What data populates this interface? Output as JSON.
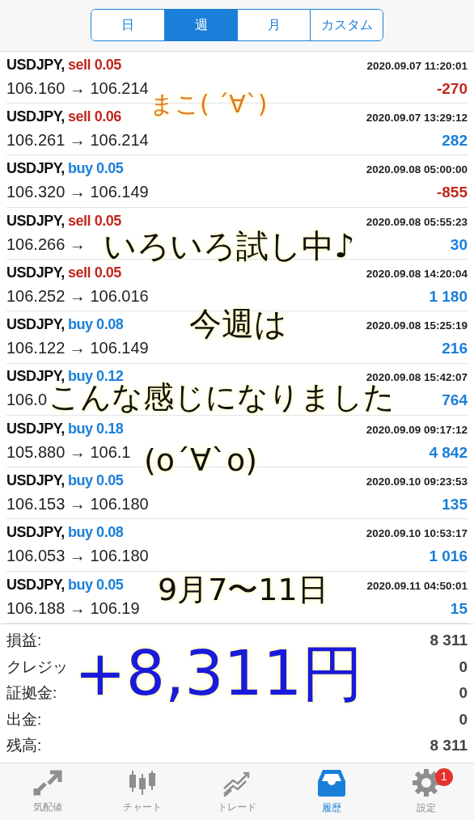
{
  "period_tabs": [
    {
      "label": "日",
      "selected": false
    },
    {
      "label": "週",
      "selected": true
    },
    {
      "label": "月",
      "selected": false
    },
    {
      "label": "カスタム",
      "selected": false
    }
  ],
  "deals": [
    {
      "symbol": "USDJPY,",
      "kind": "sell",
      "lot": "sell 0.05",
      "time": "2020.09.07 11:20:01",
      "prices": "106.160 → 106.214",
      "profit": "-270",
      "loss": true
    },
    {
      "symbol": "USDJPY,",
      "kind": "sell",
      "lot": "sell 0.06",
      "time": "2020.09.07 13:29:12",
      "prices": "106.261 → 106.214",
      "profit": "282",
      "loss": false
    },
    {
      "symbol": "USDJPY,",
      "kind": "buy",
      "lot": "buy 0.05",
      "time": "2020.09.08 05:00:00",
      "prices": "106.320 → 106.149",
      "profit": "-855",
      "loss": true
    },
    {
      "symbol": "USDJPY,",
      "kind": "sell",
      "lot": "sell 0.05",
      "time": "2020.09.08 05:55:23",
      "prices": "106.266 →",
      "profit": "30",
      "loss": false
    },
    {
      "symbol": "USDJPY,",
      "kind": "sell",
      "lot": "sell 0.05",
      "time": "2020.09.08 14:20:04",
      "prices": "106.252 → 106.016",
      "profit": "1 180",
      "loss": false
    },
    {
      "symbol": "USDJPY,",
      "kind": "buy",
      "lot": "buy 0.08",
      "time": "2020.09.08 15:25:19",
      "prices": "106.122 → 106.149",
      "profit": "216",
      "loss": false
    },
    {
      "symbol": "USDJPY,",
      "kind": "buy",
      "lot": "buy 0.12",
      "time": "2020.09.08 15:42:07",
      "prices": "106.0",
      "profit": "764",
      "loss": false
    },
    {
      "symbol": "USDJPY,",
      "kind": "buy",
      "lot": "buy 0.18",
      "time": "2020.09.09 09:17:12",
      "prices": "105.880 → 106.1",
      "profit": "4 842",
      "loss": false
    },
    {
      "symbol": "USDJPY,",
      "kind": "buy",
      "lot": "buy 0.05",
      "time": "2020.09.10 09:23:53",
      "prices": "106.153 → 106.180",
      "profit": "135",
      "loss": false
    },
    {
      "symbol": "USDJPY,",
      "kind": "buy",
      "lot": "buy 0.08",
      "time": "2020.09.10 10:53:17",
      "prices": "106.053 → 106.180",
      "profit": "1 016",
      "loss": false
    },
    {
      "symbol": "USDJPY,",
      "kind": "buy",
      "lot": "buy 0.05",
      "time": "2020.09.11 04:50:01",
      "prices": "106.188 → 106.19",
      "profit": "15",
      "loss": false
    }
  ],
  "summary": [
    {
      "label": "損益:",
      "value": "8 311"
    },
    {
      "label": "クレジッ",
      "value": "0"
    },
    {
      "label": "証拠金:",
      "value": "0"
    },
    {
      "label": "出金:",
      "value": "0"
    },
    {
      "label": "残高:",
      "value": "8 311"
    }
  ],
  "handwritten_notes": [
    {
      "text": "まこ( ´∀`)",
      "color": "#e07a2a"
    },
    {
      "text": "いろいろ試し中♪",
      "color": "#111111"
    },
    {
      "text": "今週は",
      "color": "#111111"
    },
    {
      "text": "こんな感じになりました",
      "color": "#111111"
    },
    {
      "text": "(o´∀`o)",
      "color": "#111111"
    },
    {
      "text": "9月7〜11日",
      "color": "#111111"
    },
    {
      "text": "+8,311円",
      "color": "#1a1adb"
    }
  ],
  "bottom_nav": [
    {
      "kind": "quotes",
      "label": "気配値",
      "selected": false
    },
    {
      "kind": "chart",
      "label": "チャート",
      "selected": false
    },
    {
      "kind": "trade",
      "label": "トレード",
      "selected": false
    },
    {
      "kind": "history",
      "label": "履歴",
      "selected": true
    },
    {
      "kind": "settings",
      "label": "設定",
      "selected": false,
      "badge": "1"
    }
  ]
}
